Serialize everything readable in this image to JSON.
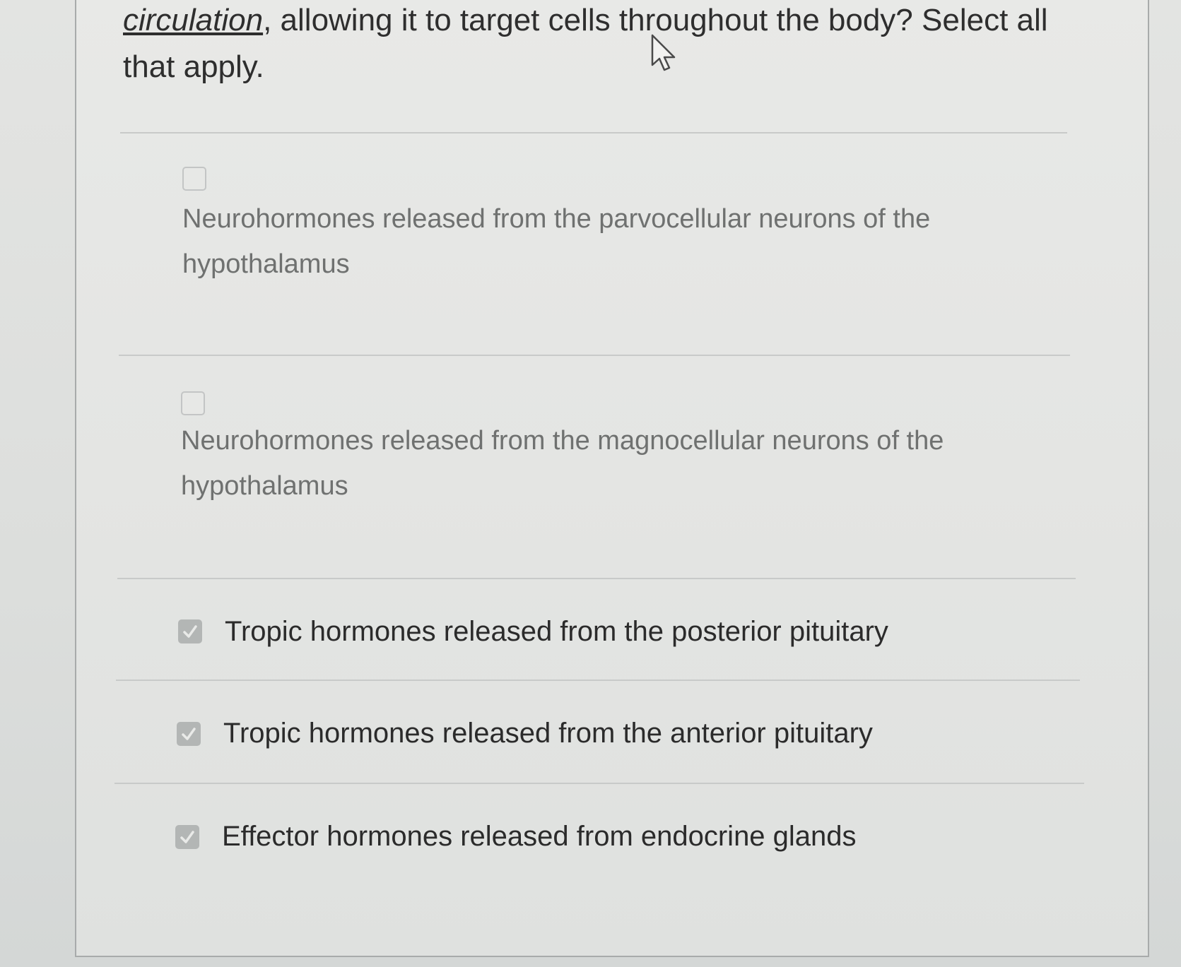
{
  "question": {
    "term": "circulation",
    "text_after_term": ", allowing it to target cells throughout the body? Select all that apply."
  },
  "options": [
    {
      "label": "Neurohormones released from the parvocellular neurons of the hypothalamus",
      "checked": false
    },
    {
      "label": "Neurohormones released from the magnocellular neurons of the hypothalamus",
      "checked": false
    },
    {
      "label": "Tropic hormones released from the posterior pituitary",
      "checked": true
    },
    {
      "label": "Tropic hormones released from the anterior pituitary",
      "checked": true
    },
    {
      "label": "Effector hormones released from endocrine glands",
      "checked": true
    }
  ],
  "icons": {
    "cursor": "mouse-pointer-icon",
    "check": "checkmark-icon"
  },
  "colors": {
    "checked_box": "#b3b6b5",
    "unchecked_border": "#c3c5c5",
    "divider": "#c8cac9"
  }
}
